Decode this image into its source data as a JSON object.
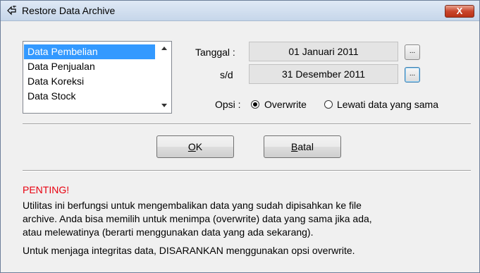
{
  "window": {
    "title": "Restore Data Archive",
    "close_label": "X",
    "title_icon": "restore-archive-icon"
  },
  "list": {
    "items": [
      {
        "label": "Data Pembelian",
        "selected": true
      },
      {
        "label": "Data Penjualan",
        "selected": false
      },
      {
        "label": "Data Koreksi",
        "selected": false
      },
      {
        "label": "Data Stock",
        "selected": false
      }
    ]
  },
  "date": {
    "from_label": "Tanggal :",
    "from_value": "01 Januari 2011",
    "to_label": "s/d",
    "to_value": "31 Desember 2011",
    "button_label": "..."
  },
  "options": {
    "label": "Opsi :",
    "overwrite_label": "Overwrite",
    "skip_label": "Lewati  data yang sama",
    "selected": "overwrite"
  },
  "buttons": {
    "ok_accel": "O",
    "ok_rest": "K",
    "cancel_accel": "B",
    "cancel_rest": "atal"
  },
  "notice": {
    "heading": "PENTING!",
    "line1": "Utilitas ini berfungsi untuk mengembalikan data yang sudah dipisahkan ke file",
    "line2": "archive. Anda bisa memilih untuk menimpa (overwrite) data yang sama jika ada,",
    "line3": "atau melewatinya (berarti menggunakan data yang ada sekarang).",
    "line4": "Untuk menjaga integritas data, DISARANKAN menggunakan opsi overwrite."
  },
  "colors": {
    "selection": "#3399ff",
    "warning": "#e8000f",
    "close_button": "#c9452c"
  }
}
